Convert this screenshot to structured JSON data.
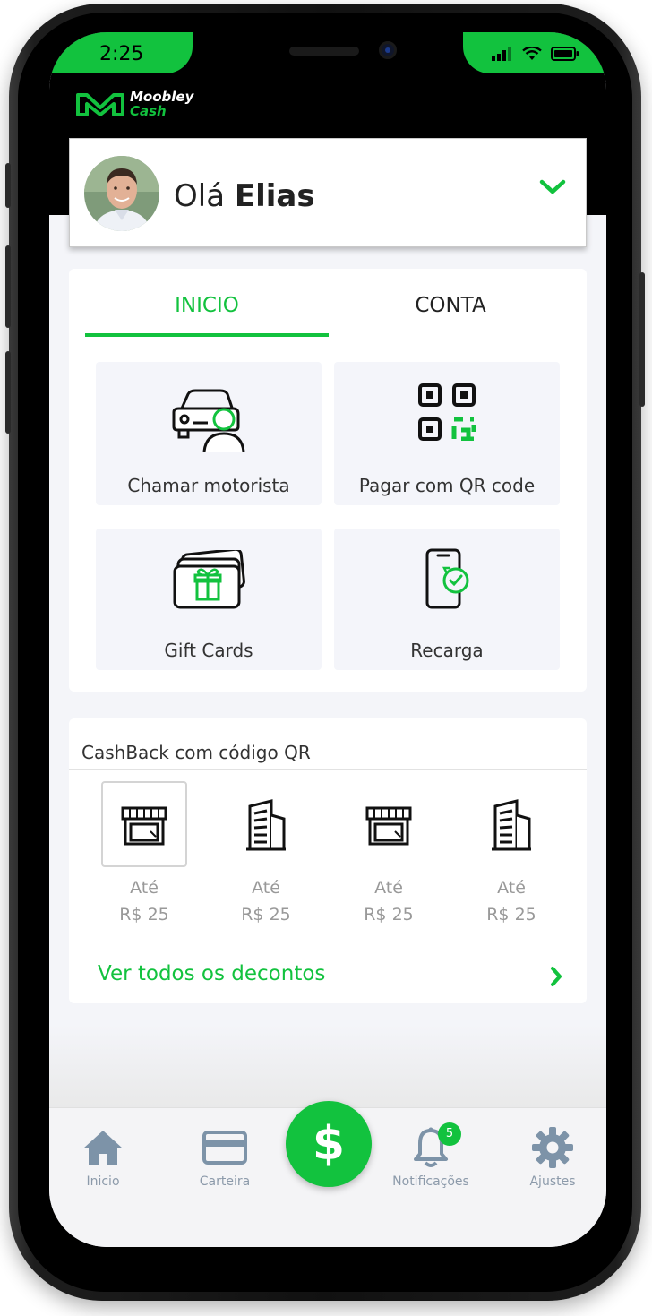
{
  "status_bar": {
    "time": "2:25"
  },
  "brand": {
    "line1": "Moobley",
    "line2": "Cash",
    "accent_color": "#12c23e"
  },
  "header": {
    "greeting_prefix": "Olá",
    "user_name": "Elias",
    "expand_icon": "chevron-down-icon"
  },
  "tabs": [
    {
      "label": "INICIO",
      "active": true
    },
    {
      "label": "CONTA",
      "active": false
    }
  ],
  "actions": [
    {
      "label": "Chamar motorista",
      "icon": "car-driver-icon"
    },
    {
      "label": "Pagar com QR code",
      "icon": "qr-code-icon"
    },
    {
      "label": "Gift Cards",
      "icon": "gift-card-icon"
    },
    {
      "label": "Recarga",
      "icon": "phone-recharge-icon"
    }
  ],
  "cashback": {
    "title": "CashBack com código QR",
    "merchants": [
      {
        "icon": "store-icon",
        "line1": "Até",
        "line2": "R$ 25",
        "selected": true
      },
      {
        "icon": "building-icon",
        "line1": "Até",
        "line2": "R$ 25",
        "selected": false
      },
      {
        "icon": "store-icon",
        "line1": "Até",
        "line2": "R$ 25",
        "selected": false
      },
      {
        "icon": "building-icon",
        "line1": "Até",
        "line2": "R$ 25",
        "selected": false
      }
    ],
    "see_all": "Ver todos os decontos"
  },
  "bottom_nav": {
    "items": [
      {
        "label": "Inicio",
        "icon": "home-icon"
      },
      {
        "label": "Carteira",
        "icon": "card-icon"
      },
      {
        "label": "Notificações",
        "icon": "bell-icon",
        "badge": "5"
      },
      {
        "label": "Ajustes",
        "icon": "gear-icon"
      }
    ],
    "center_symbol": "$"
  }
}
